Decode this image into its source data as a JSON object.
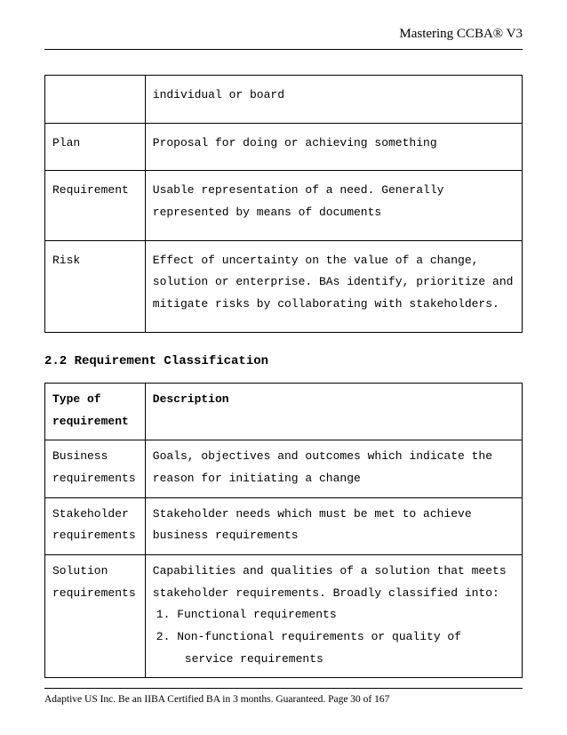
{
  "header": {
    "title": "Mastering CCBA® V3"
  },
  "table1": {
    "rows": [
      {
        "term": "",
        "desc": "individual or board"
      },
      {
        "term": "Plan",
        "desc": "Proposal for doing or achieving something"
      },
      {
        "term": "Requirement",
        "desc": "Usable representation of a need. Generally represented by means of documents"
      },
      {
        "term": "Risk",
        "desc": "Effect of uncertainty on the value of a change, solution or enterprise. BAs identify, prioritize and mitigate risks by collaborating with stakeholders."
      }
    ]
  },
  "section": {
    "heading": "2.2 Requirement Classification"
  },
  "table2": {
    "header": {
      "col1": "Type of requirement",
      "col2": "Description"
    },
    "rows": [
      {
        "term": "Business requirements",
        "desc": "Goals, objectives and outcomes which indicate the reason for initiating a change"
      },
      {
        "term": "Stakeholder requirements",
        "desc": "Stakeholder needs which must be met to achieve business requirements"
      },
      {
        "term": "Solution requirements",
        "desc_intro": "Capabilities and qualities of a solution that meets stakeholder requirements. Broadly classified into:",
        "list": {
          "n1": "1.",
          "i1": "Functional requirements",
          "n2": "2.",
          "i2": "Non-functional requirements or quality of",
          "i2b": "service requirements"
        }
      }
    ]
  },
  "footer": {
    "text": "Adaptive US Inc. Be an IIBA Certified BA in 3 months. Guaranteed. Page 30 of 167"
  }
}
